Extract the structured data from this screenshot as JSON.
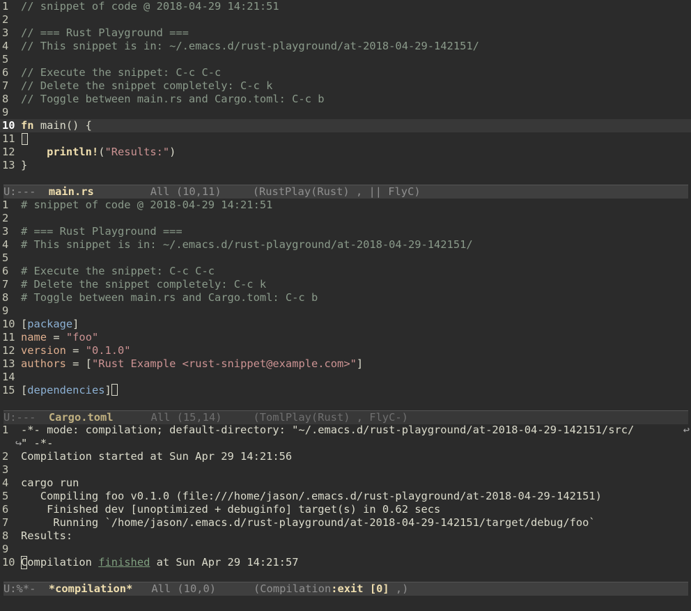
{
  "window1": {
    "lines": [
      {
        "n": "1",
        "t": "// snippet of code @ 2018-04-29 14:21:51"
      },
      {
        "n": "2",
        "t": ""
      },
      {
        "n": "3",
        "t": "// === Rust Playground ==="
      },
      {
        "n": "4",
        "t": "// This snippet is in: ~/.emacs.d/rust-playground/at-2018-04-29-142151/"
      },
      {
        "n": "5",
        "t": ""
      },
      {
        "n": "6",
        "t": "// Execute the snippet: C-c C-c"
      },
      {
        "n": "7",
        "t": "// Delete the snippet completely: C-c k"
      },
      {
        "n": "8",
        "t": "// Toggle between main.rs and Cargo.toml: C-c b"
      },
      {
        "n": "9",
        "t": ""
      },
      {
        "n": "10",
        "kw": "fn",
        "t": " main() {"
      },
      {
        "n": "11",
        "t": ""
      },
      {
        "n": "12",
        "indent": "    ",
        "macro": "println!",
        "open": "(",
        "str": "\"Results:\"",
        "close": ")"
      },
      {
        "n": "13",
        "t": "}"
      }
    ],
    "modeline": {
      "status": "U:---  ",
      "buffer": "main.rs",
      "position": "All (10,11)",
      "modes": "(RustPlay(Rust) , || FlyC)"
    }
  },
  "window2": {
    "lines": [
      {
        "n": "1",
        "t": "# snippet of code @ 2018-04-29 14:21:51"
      },
      {
        "n": "2",
        "t": ""
      },
      {
        "n": "3",
        "t": "# === Rust Playground ==="
      },
      {
        "n": "4",
        "t": "# This snippet is in: ~/.emacs.d/rust-playground/at-2018-04-29-142151/"
      },
      {
        "n": "5",
        "t": ""
      },
      {
        "n": "6",
        "t": "# Execute the snippet: C-c C-c"
      },
      {
        "n": "7",
        "t": "# Delete the snippet completely: C-c k"
      },
      {
        "n": "8",
        "t": "# Toggle between main.rs and Cargo.toml: C-c b"
      },
      {
        "n": "9",
        "t": ""
      },
      {
        "n": "10",
        "section": "package"
      },
      {
        "n": "11",
        "key": "name",
        "eq": " = ",
        "str": "\"foo\""
      },
      {
        "n": "12",
        "key": "version",
        "eq": " = ",
        "str": "\"0.1.0\""
      },
      {
        "n": "13",
        "key": "authors",
        "eq": " = [",
        "str": "\"Rust Example <rust-snippet@example.com>\"",
        "close": "]"
      },
      {
        "n": "14",
        "t": ""
      },
      {
        "n": "15",
        "section": "dependencies"
      }
    ],
    "modeline": {
      "status": "U:---  ",
      "buffer": "Cargo.toml",
      "position": "All (15,14)",
      "modes": "(TomlPlay(Rust) , FlyC-)"
    }
  },
  "window3": {
    "lines": [
      {
        "n": "1",
        "t": "-*- mode: compilation; default-directory: \"~/.emacs.d/rust-playground/at-2018-04-29-142151/src/"
      },
      {
        "n": "",
        "t": "\" -*-"
      },
      {
        "n": "2",
        "t": "Compilation started at Sun Apr 29 14:21:56"
      },
      {
        "n": "3",
        "t": ""
      },
      {
        "n": "4",
        "t": "cargo run"
      },
      {
        "n": "5",
        "t": "   Compiling foo v0.1.0 (file:///home/jason/.emacs.d/rust-playground/at-2018-04-29-142151)"
      },
      {
        "n": "6",
        "t": "    Finished dev [unoptimized + debuginfo] target(s) in 0.62 secs"
      },
      {
        "n": "7",
        "t": "     Running `/home/jason/.emacs.d/rust-playground/at-2018-04-29-142151/target/debug/foo`"
      },
      {
        "n": "8",
        "t": "Results:"
      },
      {
        "n": "9",
        "t": ""
      },
      {
        "n": "10",
        "first": "C",
        "pre": "ompilation ",
        "link": "finished",
        "post": " at Sun Apr 29 14:21:57"
      }
    ],
    "modeline": {
      "status": "U:%*-  ",
      "buffer": "*compilation*",
      "position": "All (10,0)",
      "modes_pre": "(Compilation",
      "exit": ":exit [0]",
      "modes_post": " ,)"
    }
  }
}
